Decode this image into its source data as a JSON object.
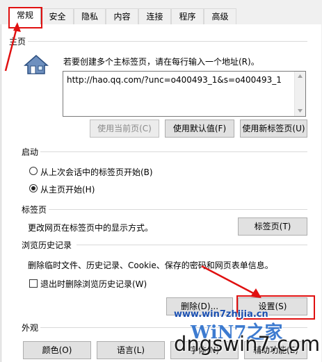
{
  "tabs": [
    "常规",
    "安全",
    "隐私",
    "内容",
    "连接",
    "程序",
    "高级"
  ],
  "home": {
    "section": "主页",
    "instruction": "若要创建多个主标签页，请在每行输入一个地址(R)。",
    "url": "http://hao.qq.com/?unc=o400493_1&s=o400493_1",
    "btn_current": "使用当前页(C)",
    "btn_default": "使用默认值(F)",
    "btn_newtab": "使用新标签页(U)"
  },
  "startup": {
    "section": "启动",
    "opt1": "从上次会话中的标签页开始(B)",
    "opt2": "从主页开始(H)"
  },
  "tabsec": {
    "section": "标签页",
    "desc": "更改网页在标签页中的显示方式。",
    "btn": "标签页(T)"
  },
  "history": {
    "section": "浏览历史记录",
    "desc": "删除临时文件、历史记录、Cookie、保存的密码和网页表单信息。",
    "checkbox": "退出时删除浏览历史记录(W)",
    "btn_delete": "删除(D)...",
    "btn_settings": "设置(S)"
  },
  "appearance": {
    "section": "外观",
    "btn_colors": "颜色(O)",
    "btn_languages": "语言(L)",
    "btn_fonts": "字体(N)",
    "btn_access": "辅助功能(E)"
  },
  "watermark": {
    "site": "www.win7zhijia.cn",
    "logo": "WiN7之家",
    "big": "dngswin7.com"
  },
  "colors": {
    "highlight": "#e01010"
  }
}
